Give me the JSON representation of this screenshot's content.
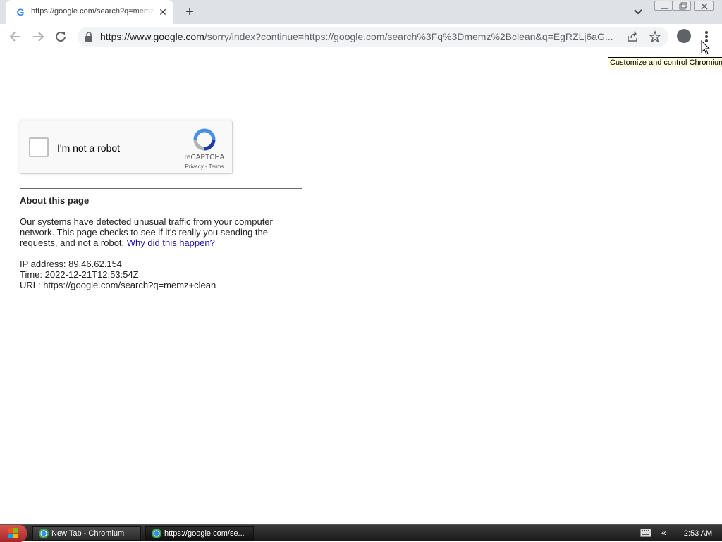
{
  "tab": {
    "title": "https://google.com/search?q=memz+clean",
    "favicon": "G"
  },
  "toolbar": {
    "url_prefix": "https://www.google.com",
    "url_rest": "/sorry/index?continue=https://google.com/search%3Fq%3Dmemz%2Bclean&q=EgRZLj6aG..."
  },
  "tooltip": {
    "text": "Customize and control Chromium"
  },
  "recaptcha": {
    "label": "I'm not a robot",
    "brand": "reCAPTCHA",
    "links": "Privacy - Terms"
  },
  "about": {
    "heading": "About this page",
    "paragraph": "Our systems have detected unusual traffic from your computer network. This page checks to see if it's really you sending the requests, and not a robot.",
    "link": "Why did this happen?"
  },
  "info": {
    "ip": "IP address: 89.46.62.154",
    "time": "Time: 2022-12-21T12:53:54Z",
    "url": "URL: https://google.com/search?q=memz+clean"
  },
  "taskbar": {
    "task1": "New Tab - Chromium",
    "task2": "https://google.com/se...",
    "clock": "2:53 AM",
    "tray_arrow": "«"
  },
  "colors": {
    "tabstrip": "#dee1e6",
    "link": "#1a0dab",
    "tooltip_bg": "#ffffe1"
  }
}
